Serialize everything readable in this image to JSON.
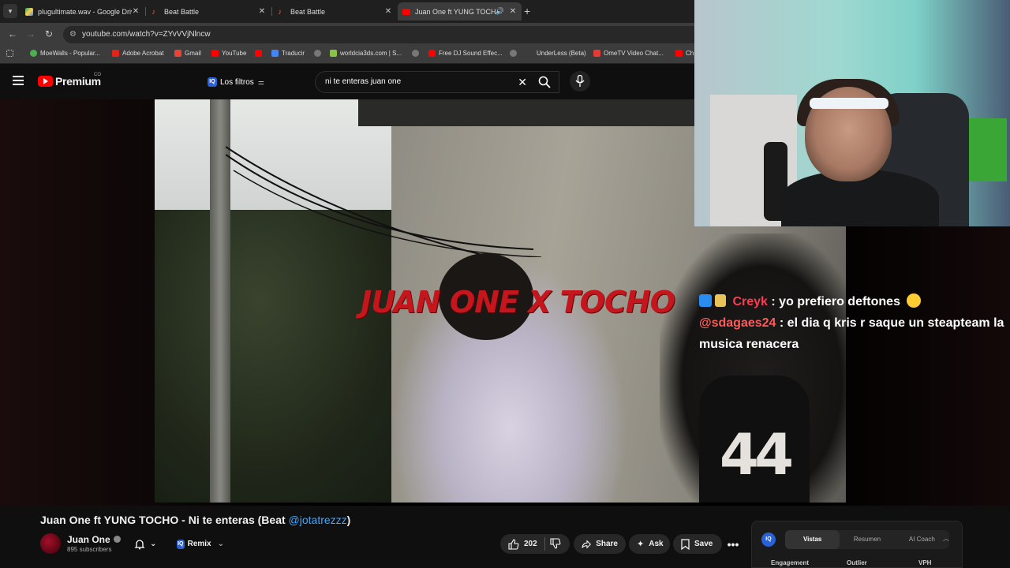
{
  "browser": {
    "tabs": [
      {
        "title": "plugultimate.wav - Google Driv",
        "active": false
      },
      {
        "title": "Beat Battle",
        "active": false
      },
      {
        "title": "Beat Battle",
        "active": false
      },
      {
        "title": "Juan One ft YUNG TOCHO",
        "active": true
      }
    ],
    "url": "youtube.com/watch?v=ZYvVVjNlncw",
    "bookmarks": [
      "MoeWalls - Popular...",
      "Adobe Acrobat",
      "Gmail",
      "YouTube",
      "Traducir",
      "worldcia3ds.com | S...",
      "Free DJ Sound Effec...",
      "UnderLess (Beta)",
      "OmeTV Video Chat...",
      "Ch"
    ]
  },
  "yt": {
    "logo_text": "Premium",
    "region": "CO",
    "filters_label": "Los filtros",
    "search_value": "ni te enteras juan one"
  },
  "video": {
    "overlay_title": "JUAN ONE X TOCHO",
    "jersey_number": "44"
  },
  "chat": [
    {
      "user": "Creyk",
      "message": ": yo prefiero deftones"
    },
    {
      "user": "@sdagaes24",
      "message": ": el dia q kris r saque un steapteam la musica renacera"
    }
  ],
  "meta": {
    "title_prefix": "Juan One ft YUNG TOCHO - Ni te enteras (Beat ",
    "title_mention": "@jotatrezzz",
    "title_suffix": ")",
    "channel": "Juan One",
    "subscribers": "895 subscribers",
    "remix_label": "Remix",
    "likes": "202",
    "share_label": "Share",
    "ask_label": "Ask",
    "save_label": "Save"
  },
  "iq_panel": {
    "tabs": [
      "Vistas",
      "Resumen",
      "AI Coach"
    ],
    "columns": [
      "Engagement",
      "Outlier",
      "VPH"
    ]
  },
  "colors": {
    "yt_red": "#ff0000",
    "link_blue": "#3ea6ff",
    "chat_name": "#ff3a52",
    "overlay_red": "#c4161c"
  }
}
